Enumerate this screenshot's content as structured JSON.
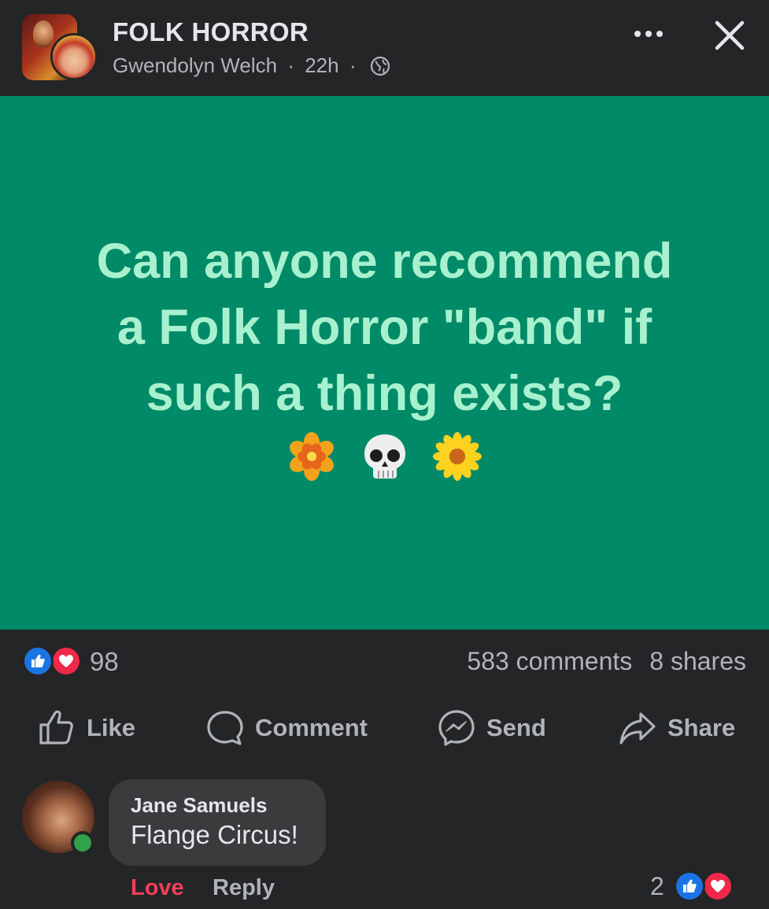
{
  "header": {
    "group_name": "FOLK HORROR",
    "author": "Gwendolyn Welch",
    "separator": "·",
    "time": "22h"
  },
  "post": {
    "lines": [
      "Can anyone recommend",
      "a Folk Horror \"band\" if",
      "such a thing exists?"
    ],
    "emojis": [
      "blossom-emoji",
      "skull-emoji",
      "sunflower-emoji"
    ],
    "background_color": "#008a67",
    "text_color": "#a8f1cf"
  },
  "reactions": {
    "count": "98",
    "comments": "583 comments",
    "shares": "8 shares"
  },
  "actions": {
    "like": "Like",
    "comment": "Comment",
    "send": "Send",
    "share": "Share"
  },
  "comment": {
    "author": "Jane Samuels",
    "text": "Flange Circus!",
    "love_label": "Love",
    "reply_label": "Reply",
    "reaction_count": "2"
  },
  "colors": {
    "background": "#242526",
    "like_blue": "#1b74e4",
    "love_red": "#f02849",
    "online_green": "#31a24c"
  }
}
